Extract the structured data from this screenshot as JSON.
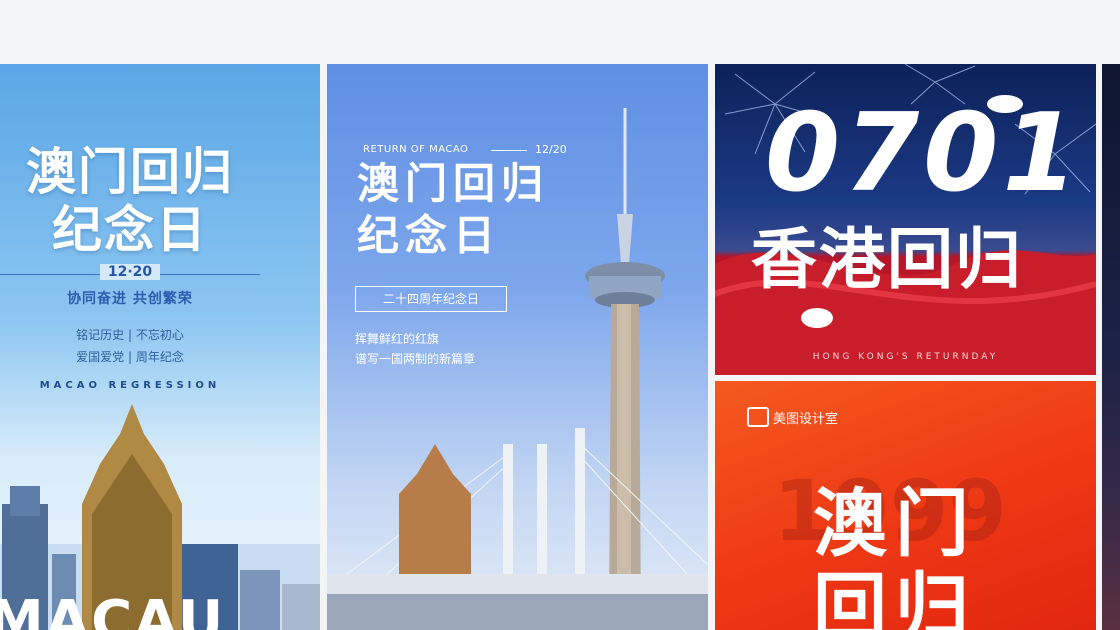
{
  "cards": [
    {
      "title_line1": "澳门回归",
      "title_line2": "纪念日",
      "date": "12·20",
      "slogan": "协同奋进  共创繁荣",
      "line_a": "铭记历史  |  不忘初心",
      "line_b": "爱国爱党  |  周年纪念",
      "english": "MACAO REGRESSION",
      "big_word": "MACAU"
    },
    {
      "english": "RETURN OF MACAO",
      "date": "12/20",
      "title_line1": "澳门回归",
      "title_line2": "纪念日",
      "box_label": "二十四周年纪念日",
      "sub_line1": "挥舞鲜红的红旗",
      "sub_line2": "谱写一国两制的新篇章"
    },
    {
      "number": "0701",
      "title": "香港回归",
      "english": "HONG KONG'S RETURNDAY"
    },
    {
      "brand": "美图设计室",
      "bg_number": "1999",
      "title_line1": "澳门",
      "title_line2": "回归"
    }
  ]
}
